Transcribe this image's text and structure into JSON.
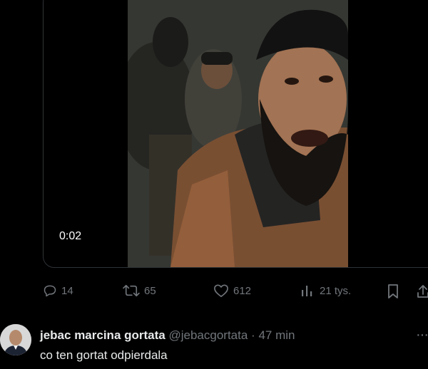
{
  "video": {
    "timestamp": "0:02"
  },
  "actions": {
    "replies": "14",
    "retweets": "65",
    "likes": "612",
    "views": "21 tys."
  },
  "reply": {
    "author_name": "jebac marcina gortata",
    "author_handle": "@jebacgortata",
    "separator": "·",
    "time": "47 min",
    "text": "co ten gortat odpierdala",
    "more_label": "···"
  },
  "colors": {
    "background": "#000000",
    "text_primary": "#e7e9ea",
    "text_secondary": "#71767b",
    "border": "#2f3336"
  }
}
